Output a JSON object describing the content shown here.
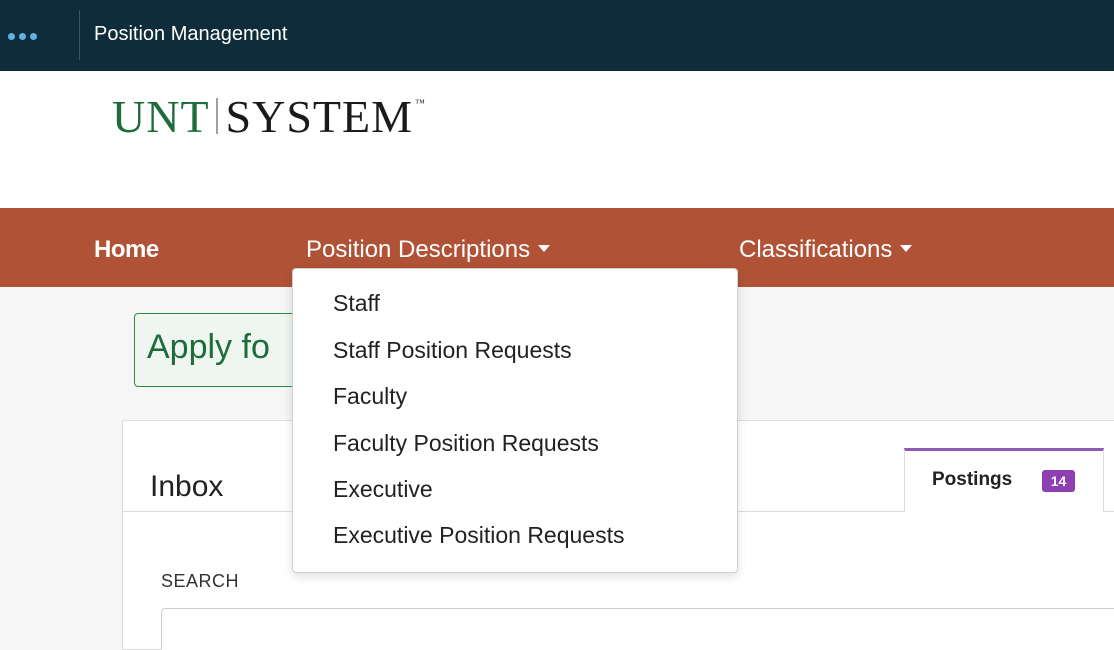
{
  "topbar": {
    "app_switcher_icon": "dots-menu-icon",
    "title": "Position Management"
  },
  "logo": {
    "part1": "UNT",
    "part2": "SYSTEM",
    "tm": "™"
  },
  "nav": {
    "home": "Home",
    "position_descriptions": "Position Descriptions",
    "classifications": "Classifications"
  },
  "dropdown": {
    "items": [
      "Staff",
      "Staff Position Requests",
      "Faculty",
      "Faculty Position Requests",
      "Executive",
      "Executive Position Requests"
    ]
  },
  "apply_button": {
    "label": "Apply fo"
  },
  "inbox": {
    "title": "Inbox",
    "tab_postings": {
      "label": "Postings",
      "count": "14"
    },
    "search_label": "SEARCH",
    "search_value": ""
  },
  "colors": {
    "topbar": "#0f2c3a",
    "navbar": "#b05236",
    "logo_green": "#1e6b3c",
    "badge": "#8e3fb3"
  }
}
